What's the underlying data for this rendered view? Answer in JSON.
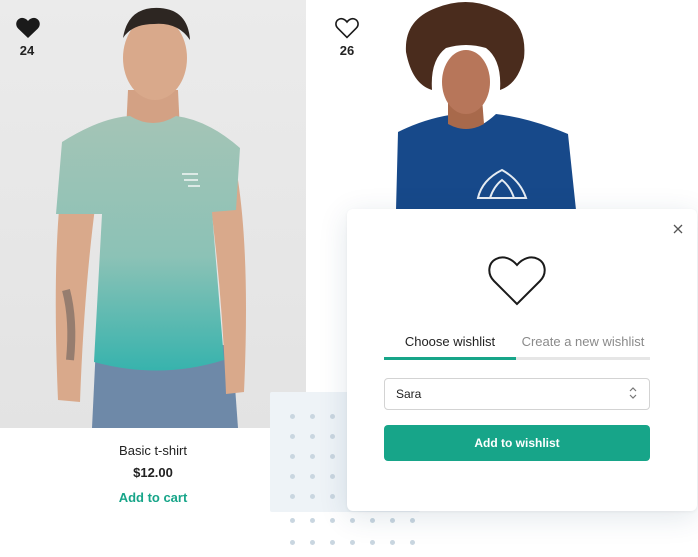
{
  "products": [
    {
      "name": "Basic t-shirt",
      "price": "$12.00",
      "add_to_cart": "Add to cart",
      "favorites_count": "24",
      "favorited": true,
      "favorite_icon": "heart-filled-icon"
    },
    {
      "favorites_count": "26",
      "favorited": false,
      "favorite_icon": "heart-outline-icon"
    }
  ],
  "wishlist_modal": {
    "close_icon": "close-icon",
    "heart_icon": "heart-outline-icon",
    "tabs": [
      {
        "label": "Choose wishlist",
        "active": true
      },
      {
        "label": "Create a new wishlist",
        "active": false
      }
    ],
    "select": {
      "value": "Sara",
      "icon": "chevron-updown-icon"
    },
    "submit_label": "Add to wishlist"
  },
  "colors": {
    "accent": "#17a589",
    "text": "#222222",
    "muted_text": "#8a8a8a",
    "shirt_1": "#9dc4b2",
    "shirt_2": "#17498a"
  }
}
